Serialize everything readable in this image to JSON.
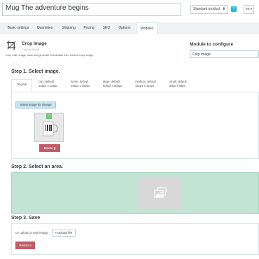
{
  "header": {
    "product_name": "Mug The adventure begins",
    "product_type": "Standard product",
    "help_icon": "help-icon",
    "language": "en"
  },
  "tabs": [
    {
      "label": "Basic settings"
    },
    {
      "label": "Quantities"
    },
    {
      "label": "Shipping"
    },
    {
      "label": "Pricing"
    },
    {
      "label": "SEO"
    },
    {
      "label": "Options"
    },
    {
      "label": "Modules",
      "active": true
    }
  ],
  "module": {
    "icon": "crop-icon",
    "title": "Crop Image",
    "author": "Crop by Lenih",
    "description": "Crop main image, save and generate thumbnails from current crops image",
    "configure_label": "Module to configure",
    "configure_value": "Crop image"
  },
  "step1": {
    "title": "Step 1. Select image.",
    "image_tabs": [
      {
        "name": "Original",
        "size": "",
        "active": true
      },
      {
        "name": "cart_default",
        "size": "125px x 125px"
      },
      {
        "name": "home_default",
        "size": "250px x 250px"
      },
      {
        "name": "large_default",
        "size": "800px x 800px"
      },
      {
        "name": "medium_default",
        "size": "452px x 452px"
      },
      {
        "name": "small_default",
        "size": "98px x 98px"
      }
    ],
    "select_button": "Select image for change",
    "delete_button": "Delete"
  },
  "step2": {
    "title": "Step 2. Select an area.",
    "placeholder_icon": "image-icon"
  },
  "step3": {
    "title": "Step 3. Save",
    "upload_label": "Or upload a new image",
    "upload_button": "Upload file",
    "resize_button": "Resize"
  },
  "colors": {
    "accent": "#25b9d7",
    "danger": "#c05c67",
    "crop_bg": "#c3e3d4",
    "success": "#72c279"
  }
}
